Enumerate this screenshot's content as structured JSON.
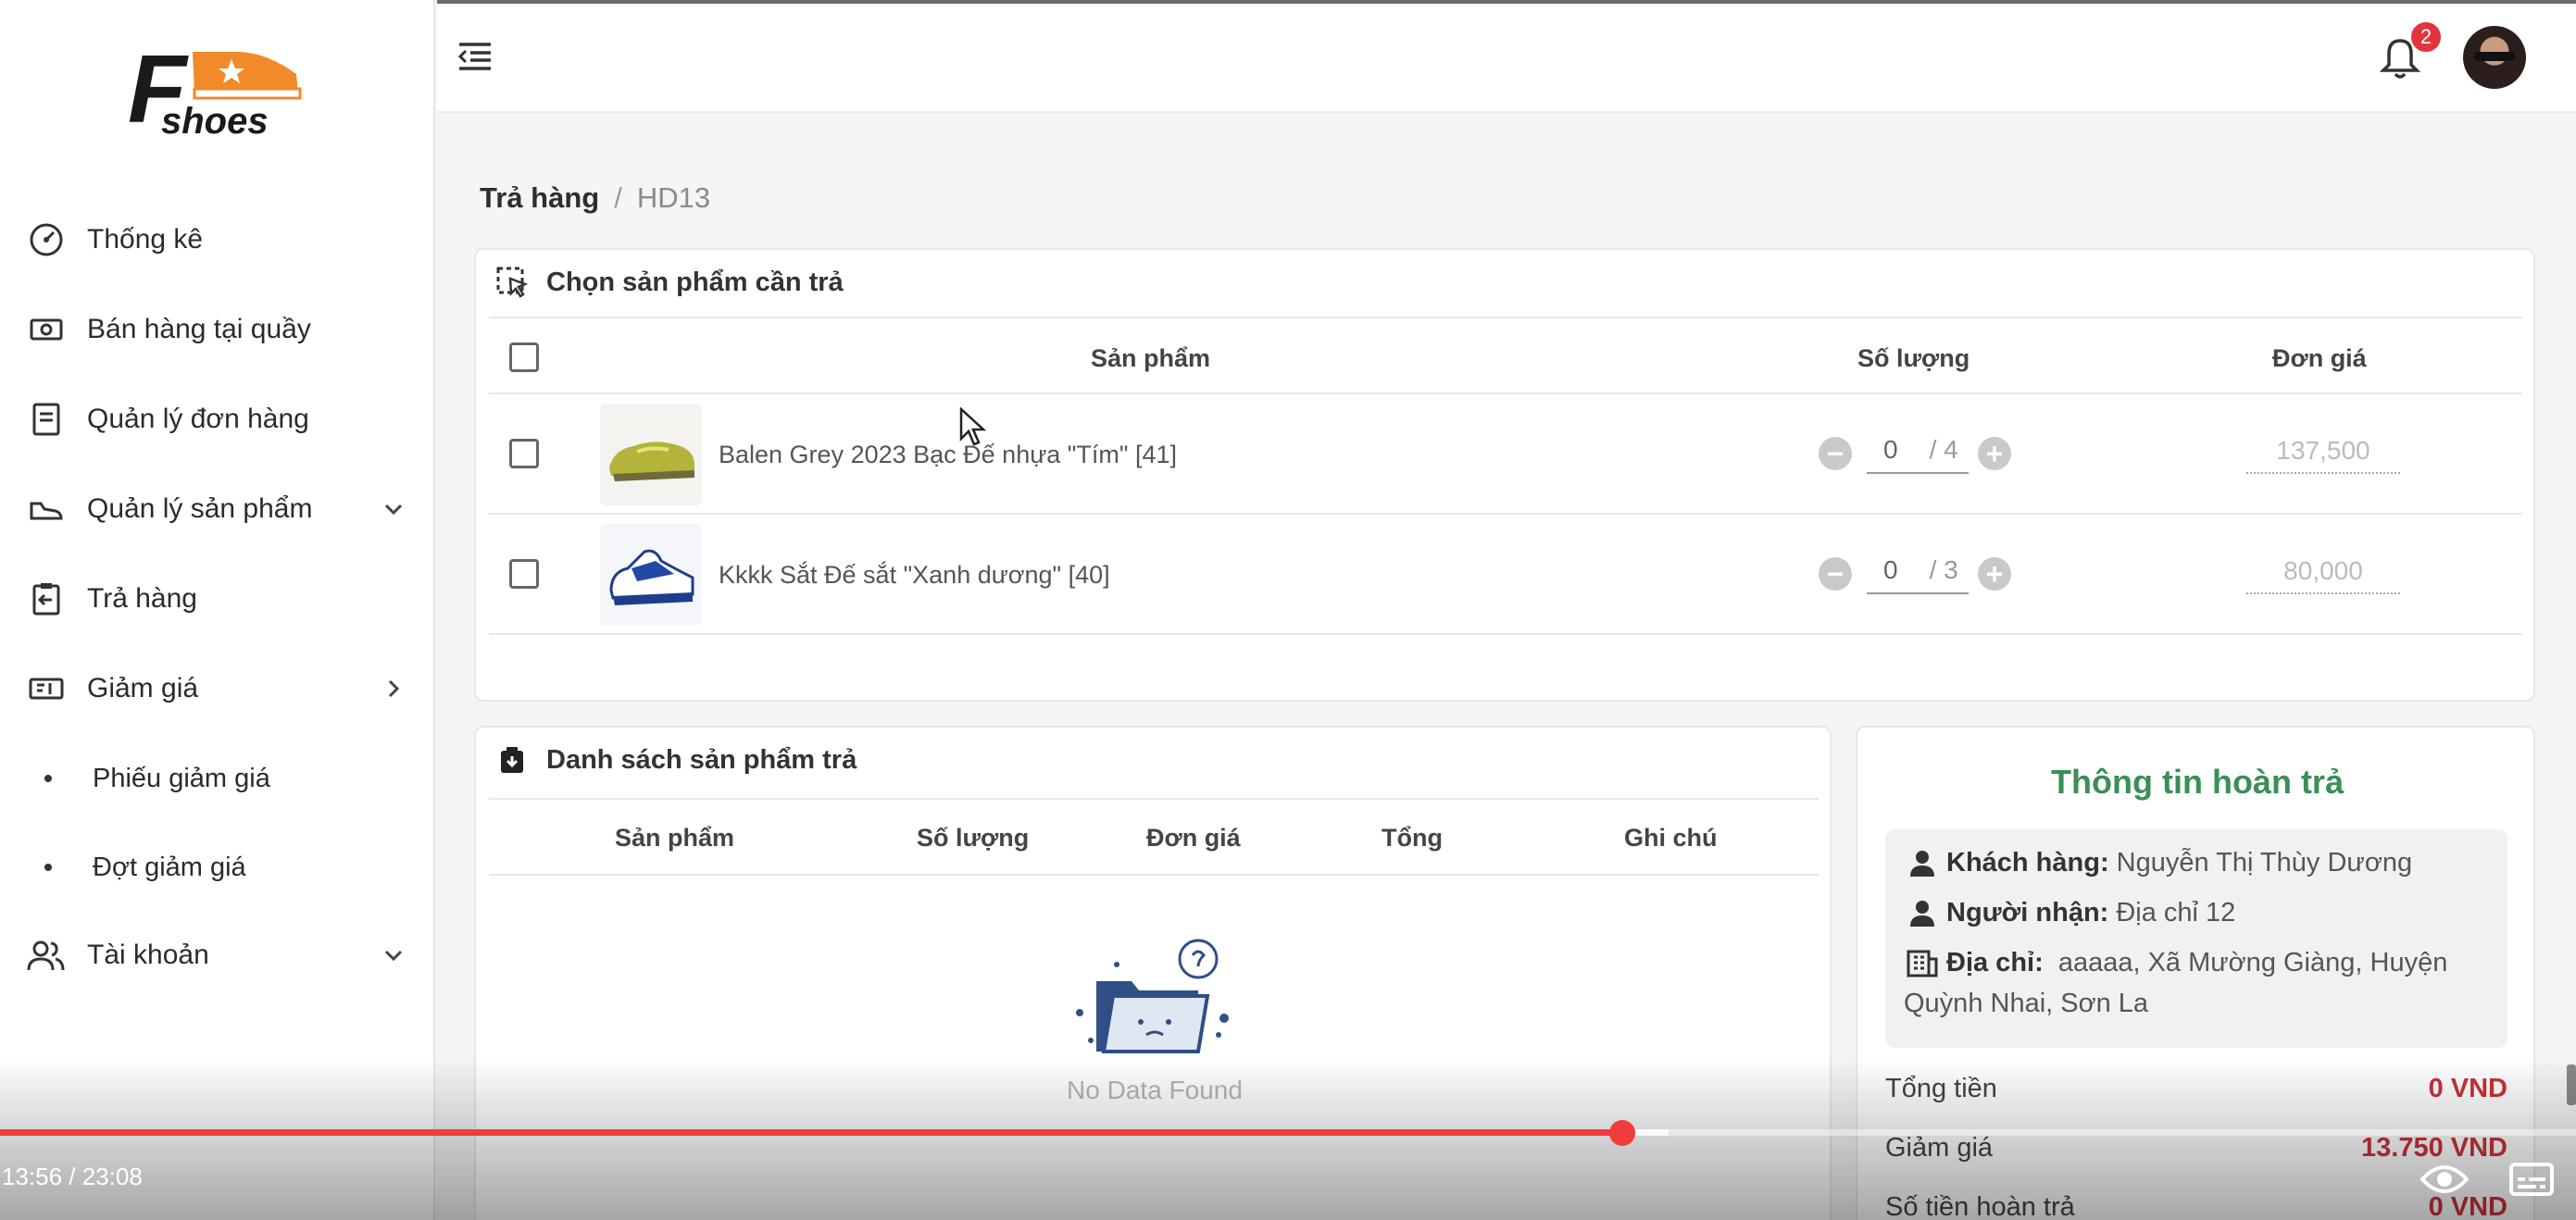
{
  "brand": {
    "logo_letter": "F",
    "logo_text": "shoes"
  },
  "sidebar": {
    "items": [
      {
        "label": "Thống kê",
        "icon": "dashboard-gauge-icon"
      },
      {
        "label": "Bán hàng tại quầy",
        "icon": "cash-icon"
      },
      {
        "label": "Quản lý đơn hàng",
        "icon": "order-document-icon"
      },
      {
        "label": "Quản lý sản phẩm",
        "icon": "shoe-icon",
        "expand": "chevron-down"
      },
      {
        "label": "Trả hàng",
        "icon": "return-clipboard-icon"
      },
      {
        "label": "Giảm giá",
        "icon": "voucher-icon",
        "expand": "chevron-right"
      },
      {
        "label": "Phiếu giảm giá"
      },
      {
        "label": "Đợt giảm giá"
      },
      {
        "label": "Tài khoản",
        "icon": "users-icon",
        "expand": "chevron-down"
      }
    ]
  },
  "header": {
    "notification_count": "2"
  },
  "breadcrumb": {
    "root": "Trả hàng",
    "separator": "/",
    "current": "HD13"
  },
  "select_products": {
    "title": "Chọn sản phẩm cần trả",
    "columns": [
      "Sản phẩm",
      "Số lượng",
      "Đơn giá"
    ],
    "rows": [
      {
        "name": "Balen Grey 2023 Bạc Đế nhựa \"Tím\" [41]",
        "qty": "0",
        "max": "/ 4",
        "price": "137,500"
      },
      {
        "name": "Kkkk Sắt Đế sắt \"Xanh dương\" [40]",
        "qty": "0",
        "max": "/ 3",
        "price": "80,000"
      }
    ]
  },
  "return_list": {
    "title": "Danh sách sản phẩm trả",
    "columns": [
      "Sản phẩm",
      "Số lượng",
      "Đơn giá",
      "Tổng",
      "Ghi chú"
    ],
    "empty_text": "No Data Found"
  },
  "refund_info": {
    "title": "Thông tin hoàn trả",
    "customer_label": "Khách hàng:",
    "customer": "Nguyễn Thị Thùy Dương",
    "receiver_label": "Người nhận:",
    "receiver": "Địa chỉ 12",
    "address_label": "Địa chỉ:",
    "address": "aaaaa, Xã Mường Giàng, Huyện Quỳnh Nhai, Sơn La",
    "total_label": "Tổng tiền",
    "total": "0 VND",
    "discount_label": "Giảm giá",
    "discount": "13.750 VND",
    "refund_label": "Số tiền hoàn trả",
    "refund": "0 VND",
    "accent_color": "#3b8f56",
    "money_color": "#c8323a"
  },
  "video": {
    "timecode": "13:56 / 23:08",
    "played_fraction": 0.6297,
    "buffered_fraction": 0.6479,
    "progress_color": "#f23b3b"
  }
}
